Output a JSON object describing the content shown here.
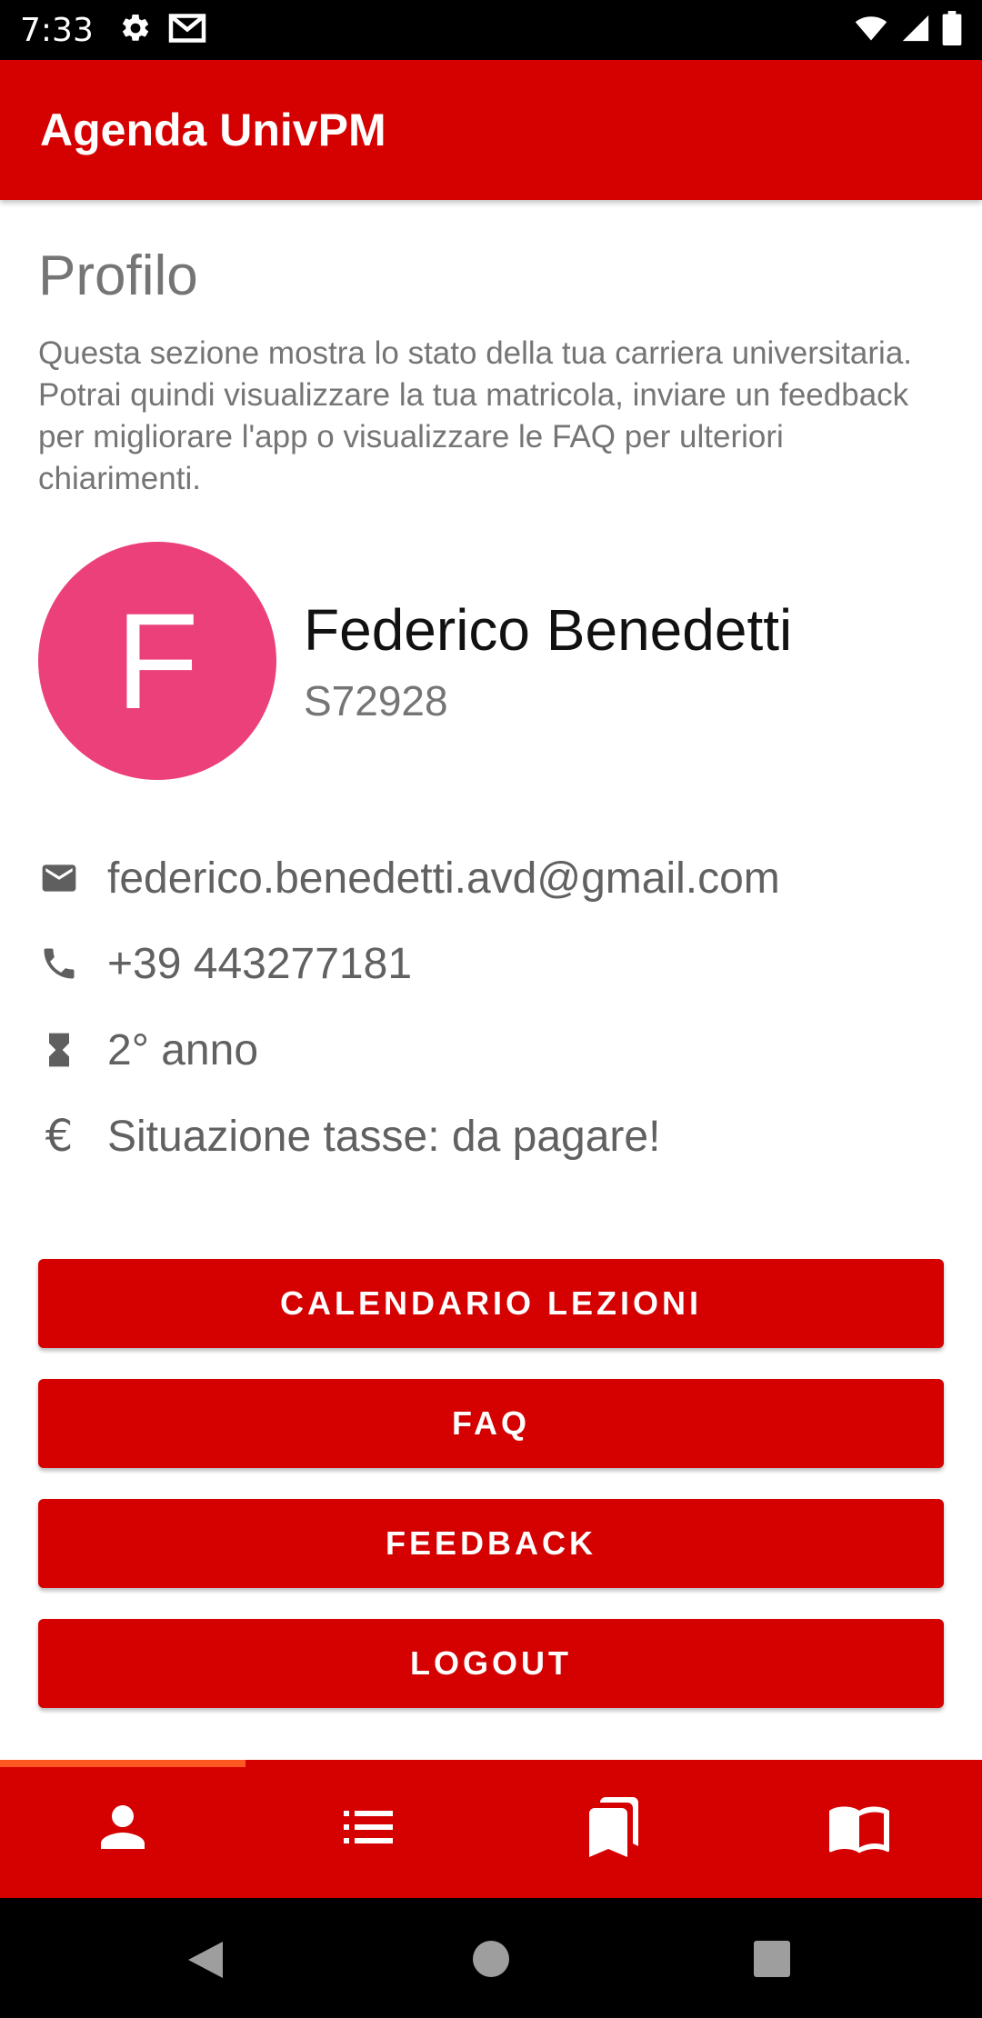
{
  "status_bar": {
    "time": "7:33",
    "icons": [
      "settings-icon",
      "gmail-icon",
      "wifi-icon",
      "signal-icon",
      "battery-icon"
    ]
  },
  "app_bar": {
    "title": "Agenda UnivPM"
  },
  "profile_section": {
    "title": "Profilo",
    "description": "Questa sezione mostra lo stato della tua carriera universitaria. Potrai quindi visualizzare la tua matricola, inviare un feedback per migliorare l'app o visualizzare le FAQ per ulteriori chiarimenti."
  },
  "user": {
    "avatar_letter": "F",
    "avatar_color": "#ec407a",
    "name": "Federico Benedetti",
    "id": "S72928"
  },
  "info": [
    {
      "icon": "email-icon",
      "text": "federico.benedetti.avd@gmail.com"
    },
    {
      "icon": "phone-icon",
      "text": "+39 443277181"
    },
    {
      "icon": "hourglass-icon",
      "text": "2° anno"
    },
    {
      "icon": "euro-icon",
      "text": "€",
      "label": "Situazione tasse: da pagare!"
    }
  ],
  "buttons": {
    "calendar": "CALENDARIO LEZIONI",
    "faq": "FAQ",
    "feedback": "FEEDBACK",
    "logout": "LOGOUT"
  },
  "bottom_nav": {
    "items": [
      "profile-icon",
      "list-icon",
      "bookmarks-icon",
      "book-icon"
    ],
    "selected": "profile-icon"
  },
  "colors": {
    "primary": "#d50000",
    "indicator": "#ff5722"
  }
}
